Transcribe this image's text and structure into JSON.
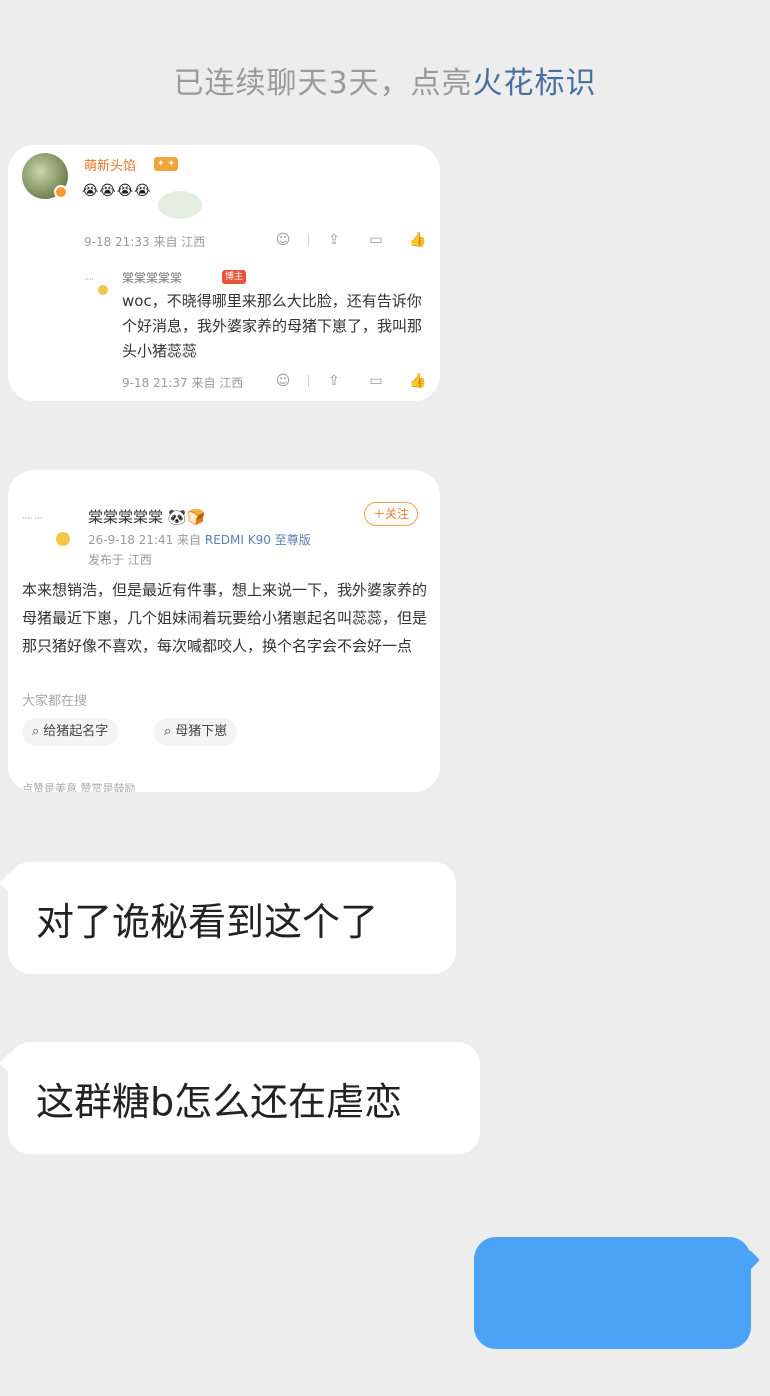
{
  "banner": {
    "prefix": "已连续聊天3天，点亮",
    "link": "火花标识"
  },
  "card1": {
    "author": "萌新头馅",
    "emojis": "😭😭😭😭",
    "meta": "9-18 21:33 来自 江西",
    "reply": {
      "author": "棠棠棠棠棠",
      "tag": "博主",
      "text": "woc，不晓得哪里来那么大比脸，还有告诉你个好消息，我外婆家养的母猪下崽了，我叫那头小猪蕊蕊",
      "meta": "9-18 21:37 来自 江西"
    }
  },
  "card2": {
    "author": "棠棠棠棠棠",
    "author_emoji": "🐼🍞",
    "follow": "＋关注",
    "meta_prefix": "26-9-18 21:41 来自 ",
    "device": "REDMI K90 至尊版",
    "location": "发布于 江西",
    "text": "本来想销浩，但是最近有件事，想上来说一下，我外婆家养的母猪最近下崽，几个姐妹闹着玩要给小猪崽起名叫蕊蕊，但是那只猪好像不喜欢，每次喊都咬人，换个名字会不会好一点",
    "hint": "大家都在搜",
    "chips": [
      "给猪起名字",
      "母猪下崽"
    ],
    "cut": "点赞是美意  赞赏是鼓励"
  },
  "messages": [
    {
      "text": "对了诡秘看到这个了"
    },
    {
      "text": "这群糖b怎么还在虐恋"
    }
  ],
  "my_message": {
    "text": "…"
  }
}
